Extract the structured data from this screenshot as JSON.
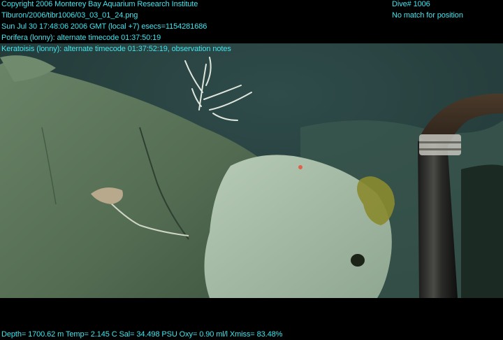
{
  "header": {
    "copyright": "Copyright 2006 Monterey Bay Aquarium Research Institute",
    "file_path": "Tiburon/2006/tibr1006/03_03_01_24.png",
    "datetime": "Sun Jul 30 17:48:06 2006 GMT (local +7)  esecs=1154281686",
    "porifera_note": "Porifera (lonny): alternate timecode 01:37:50:19",
    "keratoisis_note": "Keratoisis (lonny): alternate timecode 01:37:52:19, observation notes"
  },
  "dive": {
    "number": "Dive# 1006",
    "position_status": "No match for position"
  },
  "footer": {
    "telemetry": "Depth= 1700.62 m  Temp= 2.145 C  Sal= 34.498 PSU  Oxy= 0.90 ml/l  Xmiss= 83.48%"
  },
  "colors": {
    "overlay_text": "#3ee6f0",
    "water": "#2c4848",
    "rock": "#5a7358",
    "sponge": "#a8bfa8"
  }
}
